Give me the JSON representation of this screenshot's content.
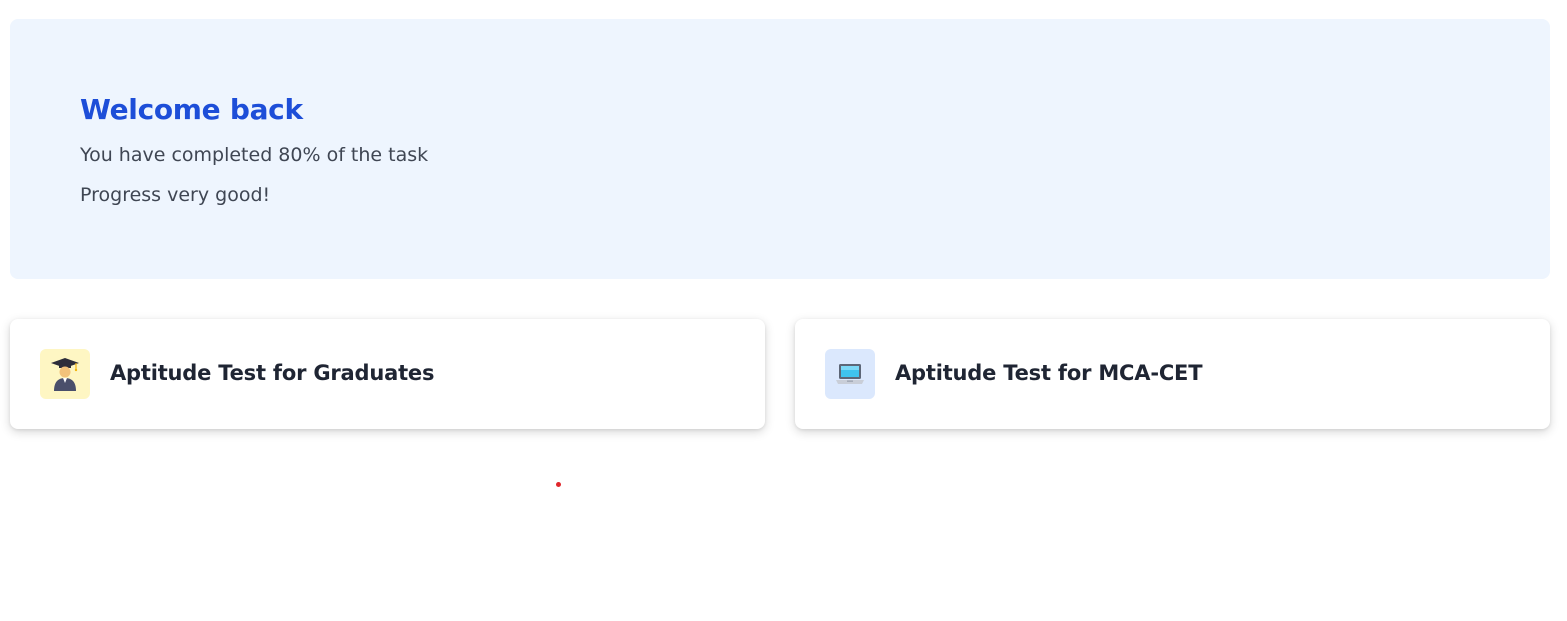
{
  "banner": {
    "title": "Welcome back",
    "progress_text": "You have completed 80% of the task",
    "progress_percent": 80,
    "status_text": "Progress very good!"
  },
  "tests": [
    {
      "label": "Aptitude Test for Graduates",
      "icon": "graduate-icon",
      "icon_bg": "#fef6c3"
    },
    {
      "label": "Aptitude Test for MCA-CET",
      "icon": "laptop-icon",
      "icon_bg": "#dbe8fd"
    }
  ],
  "colors": {
    "accent": "#1d4ed8",
    "banner_bg": "#eef5fe",
    "body_text": "#3f4653",
    "card_text": "#1f2533",
    "dot": "#e0262b"
  }
}
